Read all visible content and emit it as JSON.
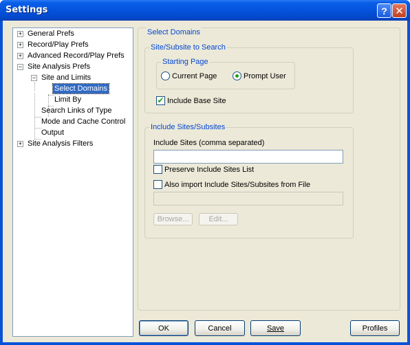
{
  "window": {
    "title": "Settings",
    "help_glyph": "?",
    "close_glyph": "✕",
    "accent": "#0A53D8"
  },
  "tree": {
    "expand_glyph": "+",
    "collapse_glyph": "−",
    "items": [
      {
        "label": "General Prefs"
      },
      {
        "label": "Record/Play Prefs"
      },
      {
        "label": "Advanced Record/Play Prefs"
      },
      {
        "label": "Site Analysis Prefs"
      },
      {
        "label": "Site and Limits"
      },
      {
        "label": "Select Domains",
        "selected": true
      },
      {
        "label": "Limit By"
      },
      {
        "label": "Search Links of Type"
      },
      {
        "label": "Mode and Cache Control"
      },
      {
        "label": "Output"
      },
      {
        "label": "Site Analysis Filters"
      }
    ]
  },
  "panel": {
    "title": "Select Domains",
    "site_group": {
      "title": "Site/Subsite to Search",
      "starting_page": {
        "title": "Starting Page",
        "option_current": "Current Page",
        "option_prompt": "Prompt User",
        "selected": "Prompt User"
      },
      "include_base_site": {
        "label": "Include Base Site",
        "checked": true,
        "check_glyph": "✔"
      }
    },
    "include_group": {
      "title": "Include Sites/Subsites",
      "field_label": "Include Sites (comma separated)",
      "field_value": "",
      "preserve": {
        "label": "Preserve Include Sites List",
        "checked": false
      },
      "import_file": {
        "label": "Also import Include Sites/Subsites from File",
        "checked": false
      },
      "file_value": "",
      "browse_label": "Browse...",
      "edit_label": "Edit..."
    }
  },
  "footer": {
    "ok_label": "OK",
    "cancel_label": "Cancel",
    "save_label": "Save",
    "profiles_label": "Profiles"
  }
}
